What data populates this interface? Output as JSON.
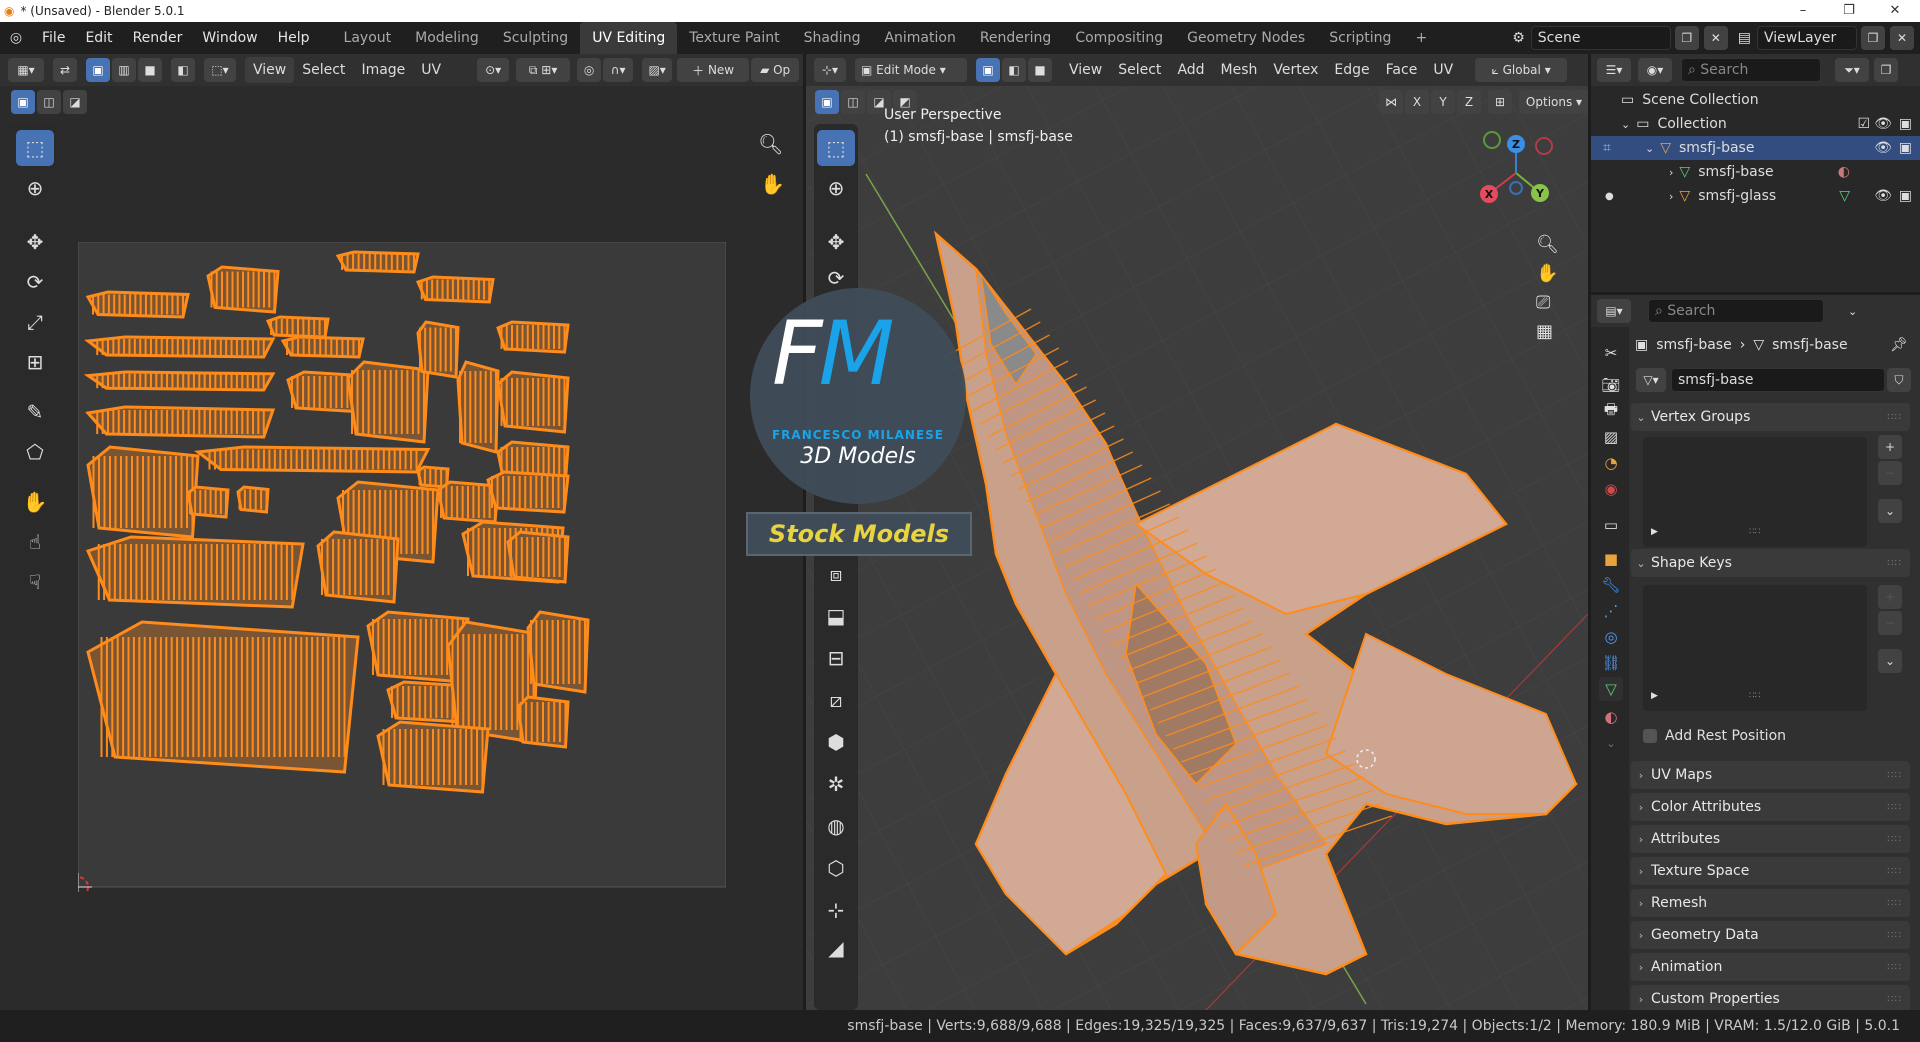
{
  "window": {
    "title": "* (Unsaved) - Blender 5.0.1",
    "minimize": "–",
    "maximize": "❐",
    "close": "✕"
  },
  "menu": [
    "File",
    "Edit",
    "Render",
    "Window",
    "Help"
  ],
  "workspaces": [
    "Layout",
    "Modeling",
    "Sculpting",
    "UV Editing",
    "Texture Paint",
    "Shading",
    "Animation",
    "Rendering",
    "Compositing",
    "Geometry Nodes",
    "Scripting",
    "+"
  ],
  "scene": {
    "name": "Scene",
    "view_layer": "ViewLayer"
  },
  "uv_editor": {
    "menus": [
      "View",
      "Select",
      "Image",
      "UV"
    ],
    "new_label": "New",
    "open_label": "Op"
  },
  "viewport": {
    "mode": "Edit Mode",
    "menus": [
      "View",
      "Select",
      "Add",
      "Mesh",
      "Vertex",
      "Edge",
      "Face",
      "UV"
    ],
    "orientation": "Global",
    "axes": [
      "X",
      "Y",
      "Z"
    ],
    "options_label": "Options",
    "info_line1": "User Perspective",
    "info_line2": "(1) smsfj-base | smsfj-base",
    "gizmo": {
      "z": "Z",
      "y": "Y",
      "x": "X"
    }
  },
  "watermark": {
    "logo": "FM",
    "name": "FRANCESCO MILANESE",
    "sub": "3D Models",
    "banner": "Stock Models"
  },
  "outliner": {
    "search_placeholder": "Search",
    "scene_collection": "Scene Collection",
    "collection": "Collection",
    "items": [
      {
        "label": "smsfj-base"
      },
      {
        "label": "smsfj-base"
      },
      {
        "label": "smsfj-glass"
      }
    ]
  },
  "properties": {
    "search_placeholder": "Search",
    "breadcrumb_obj": "smsfj-base",
    "breadcrumb_data": "smsfj-base",
    "data_name": "smsfj-base",
    "panels": {
      "vertex_groups": "Vertex Groups",
      "shape_keys": "Shape Keys",
      "add_rest": "Add Rest Position",
      "uv_maps": "UV Maps",
      "color_attributes": "Color Attributes",
      "attributes": "Attributes",
      "texture_space": "Texture Space",
      "remesh": "Remesh",
      "geometry_data": "Geometry Data",
      "animation": "Animation",
      "custom_properties": "Custom Properties"
    }
  },
  "status": "smsfj-base | Verts:9,688/9,688 | Edges:19,325/19,325 | Faces:9,637/9,637 | Tris:19,274 | Objects:1/2 | Memory: 180.9 MiB | VRAM: 1.5/12.0 GiB | 5.0.1",
  "colors": {
    "accent": "#4772b3",
    "mesh": "#ff8c1a",
    "bg": "#303030"
  }
}
